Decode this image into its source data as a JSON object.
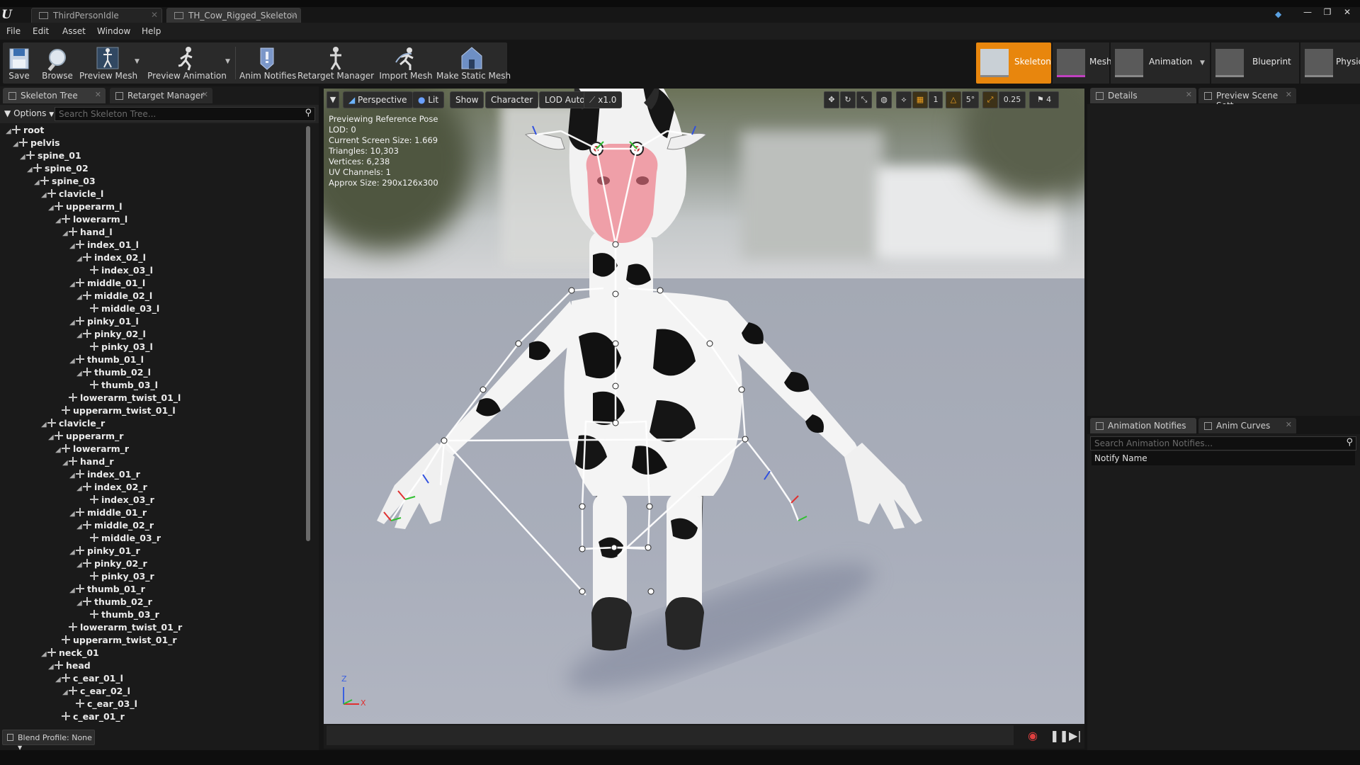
{
  "title_bar": {
    "tabs": [
      {
        "label": "ThirdPersonIdle",
        "active": false
      },
      {
        "label": "TH_Cow_Rigged_Skeleton",
        "active": true
      }
    ],
    "window_buttons": [
      "—",
      "❐",
      "✕"
    ]
  },
  "menu": {
    "items": [
      "File",
      "Edit",
      "Asset",
      "Window",
      "Help"
    ]
  },
  "toolbar": {
    "save": "Save",
    "browse": "Browse",
    "preview_mesh": "Preview Mesh",
    "preview_animation": "Preview Animation",
    "anim_notifies": "Anim Notifies",
    "retarget_manager": "Retarget Manager",
    "import_mesh": "Import Mesh",
    "make_static_mesh": "Make Static Mesh"
  },
  "modes": {
    "skeleton": "Skeleton",
    "mesh": "Mesh",
    "animation": "Animation",
    "blueprint": "Blueprint",
    "physics": "Physics",
    "active": "Skeleton",
    "accent": "#e8860d"
  },
  "left_panel": {
    "tabs": [
      "Skeleton Tree",
      "Retarget Manager"
    ],
    "options_label": "Options",
    "search_placeholder": "Search Skeleton Tree...",
    "blend_profile": "Blend Profile: None",
    "bones": [
      {
        "name": "root",
        "depth": 0
      },
      {
        "name": "pelvis",
        "depth": 1
      },
      {
        "name": "spine_01",
        "depth": 2
      },
      {
        "name": "spine_02",
        "depth": 3
      },
      {
        "name": "spine_03",
        "depth": 4
      },
      {
        "name": "clavicle_l",
        "depth": 5
      },
      {
        "name": "upperarm_l",
        "depth": 6
      },
      {
        "name": "lowerarm_l",
        "depth": 7
      },
      {
        "name": "hand_l",
        "depth": 8
      },
      {
        "name": "index_01_l",
        "depth": 9
      },
      {
        "name": "index_02_l",
        "depth": 10
      },
      {
        "name": "index_03_l",
        "depth": 11
      },
      {
        "name": "middle_01_l",
        "depth": 9
      },
      {
        "name": "middle_02_l",
        "depth": 10
      },
      {
        "name": "middle_03_l",
        "depth": 11
      },
      {
        "name": "pinky_01_l",
        "depth": 9
      },
      {
        "name": "pinky_02_l",
        "depth": 10
      },
      {
        "name": "pinky_03_l",
        "depth": 11
      },
      {
        "name": "thumb_01_l",
        "depth": 9
      },
      {
        "name": "thumb_02_l",
        "depth": 10
      },
      {
        "name": "thumb_03_l",
        "depth": 11
      },
      {
        "name": "lowerarm_twist_01_l",
        "depth": 8
      },
      {
        "name": "upperarm_twist_01_l",
        "depth": 7
      },
      {
        "name": "clavicle_r",
        "depth": 5
      },
      {
        "name": "upperarm_r",
        "depth": 6
      },
      {
        "name": "lowerarm_r",
        "depth": 7
      },
      {
        "name": "hand_r",
        "depth": 8
      },
      {
        "name": "index_01_r",
        "depth": 9
      },
      {
        "name": "index_02_r",
        "depth": 10
      },
      {
        "name": "index_03_r",
        "depth": 11
      },
      {
        "name": "middle_01_r",
        "depth": 9
      },
      {
        "name": "middle_02_r",
        "depth": 10
      },
      {
        "name": "middle_03_r",
        "depth": 11
      },
      {
        "name": "pinky_01_r",
        "depth": 9
      },
      {
        "name": "pinky_02_r",
        "depth": 10
      },
      {
        "name": "pinky_03_r",
        "depth": 11
      },
      {
        "name": "thumb_01_r",
        "depth": 9
      },
      {
        "name": "thumb_02_r",
        "depth": 10
      },
      {
        "name": "thumb_03_r",
        "depth": 11
      },
      {
        "name": "lowerarm_twist_01_r",
        "depth": 8
      },
      {
        "name": "upperarm_twist_01_r",
        "depth": 7
      },
      {
        "name": "neck_01",
        "depth": 5
      },
      {
        "name": "head",
        "depth": 6
      },
      {
        "name": "c_ear_01_l",
        "depth": 7
      },
      {
        "name": "c_ear_02_l",
        "depth": 8
      },
      {
        "name": "c_ear_03_l",
        "depth": 9
      },
      {
        "name": "c_ear_01_r",
        "depth": 7
      }
    ]
  },
  "viewport": {
    "perspective": "Perspective",
    "lit": "Lit",
    "show": "Show",
    "character": "Character",
    "lod": "LOD Auto",
    "speed": "x1.0",
    "grid_value": "1",
    "rotation_snap": "5°",
    "scale_snap": "0.25",
    "camera_speed": "4",
    "stats": [
      "Previewing Reference Pose",
      "LOD: 0",
      "Current Screen Size: 1.669",
      "Triangles: 10,303",
      "Vertices: 6,238",
      "UV Channels: 1",
      "Approx Size: 290x126x300"
    ],
    "axis_labels": {
      "z": "Z",
      "x": "X"
    }
  },
  "right_panel": {
    "top_tabs": [
      "Details",
      "Preview Scene Sett"
    ],
    "bottom_tabs": [
      "Animation Notifies",
      "Anim Curves"
    ],
    "notify_search_placeholder": "Search Animation Notifies...",
    "notify_header": "Notify Name"
  }
}
